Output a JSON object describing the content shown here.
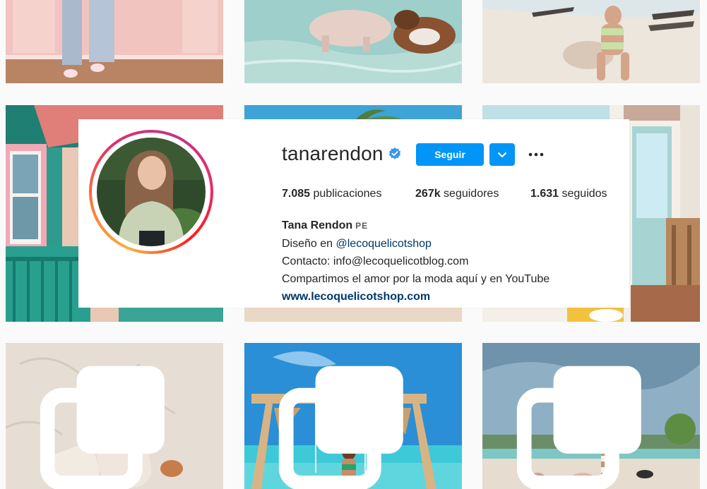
{
  "profile": {
    "username": "tanarendon",
    "follow_label": "Seguir",
    "stats": {
      "posts_count": "7.085",
      "posts_label": "publicaciones",
      "followers_count": "267k",
      "followers_label": "seguidores",
      "following_count": "1.631",
      "following_label": "seguidos"
    },
    "bio": {
      "full_name": "Tana Rendon",
      "category": "PE",
      "line1_prefix": "Diseño en",
      "line1_mention": "@lecoquelicotshop",
      "line2": "Contacto: info@lecoquelicotblog.com",
      "line3": "Compartimos el amor por la moda aquí y en YouTube",
      "website": "www.lecoquelicotshop.com"
    }
  },
  "icons": {
    "verified": "verified-badge-icon",
    "dropdown": "chevron-down-icon",
    "more": "more-options-icon",
    "multi": "multiple-photos-icon"
  },
  "colors": {
    "accent": "#0095f6",
    "verified": "#3897f0",
    "link": "#00376b",
    "text": "#262626"
  }
}
